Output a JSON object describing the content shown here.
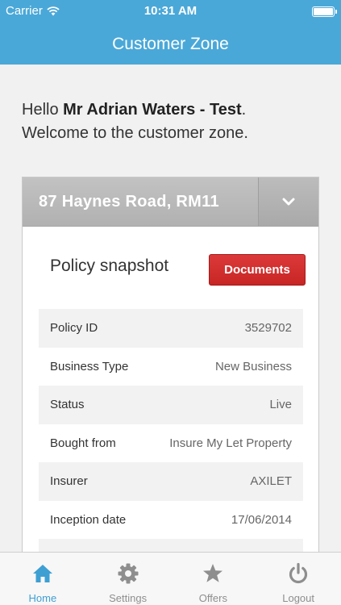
{
  "status_bar": {
    "carrier": "Carrier",
    "time": "10:31 AM"
  },
  "nav": {
    "title": "Customer Zone"
  },
  "greeting": {
    "hello": "Hello ",
    "name": "Mr Adrian Waters - Test",
    "period": ".",
    "welcome": "Welcome to the customer zone."
  },
  "property": {
    "address": "87 Haynes Road, RM11"
  },
  "snapshot": {
    "title": "Policy snapshot",
    "documents_label": "Documents",
    "rows": [
      {
        "label": "Policy ID",
        "value": "3529702"
      },
      {
        "label": "Business Type",
        "value": "New Business"
      },
      {
        "label": "Status",
        "value": "Live"
      },
      {
        "label": "Bought from",
        "value": "Insure My Let Property"
      },
      {
        "label": "Insurer",
        "value": "AXILET"
      },
      {
        "label": "Inception date",
        "value": "17/06/2014"
      },
      {
        "label": "",
        "value": ""
      }
    ]
  },
  "tabs": [
    {
      "label": "Home",
      "icon": "home-icon",
      "active": true
    },
    {
      "label": "Settings",
      "icon": "gear-icon",
      "active": false
    },
    {
      "label": "Offers",
      "icon": "star-icon",
      "active": false
    },
    {
      "label": "Logout",
      "icon": "power-icon",
      "active": false
    }
  ],
  "colors": {
    "accent": "#4aa8d8",
    "tab_active": "#3e9fd3",
    "documents_button": "#d63131"
  }
}
